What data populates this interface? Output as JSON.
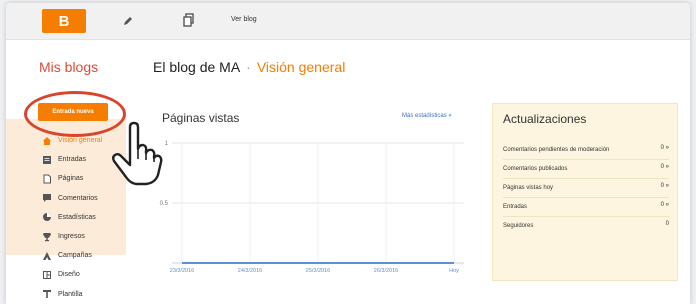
{
  "topbar": {
    "logo_letter": "B",
    "ver_blog": "Ver blog"
  },
  "header": {
    "mis_blogs": "Mis blogs",
    "blog_name": "El blog de MA",
    "separator": "·",
    "section": "Visión general"
  },
  "sidebar": {
    "new_post": "Entrada nueva",
    "items": [
      {
        "label": "Visión general",
        "icon": "home-icon"
      },
      {
        "label": "Entradas",
        "icon": "entries-icon"
      },
      {
        "label": "Páginas",
        "icon": "page-icon"
      },
      {
        "label": "Comentarios",
        "icon": "comment-icon"
      },
      {
        "label": "Estadísticas",
        "icon": "stats-icon"
      },
      {
        "label": "Ingresos",
        "icon": "trophy-icon"
      },
      {
        "label": "Campañas",
        "icon": "campaign-icon"
      },
      {
        "label": "Diseño",
        "icon": "layout-icon"
      },
      {
        "label": "Plantilla",
        "icon": "template-icon"
      }
    ]
  },
  "pageviews": {
    "title": "Páginas vistas",
    "more": "Más estadísticas »"
  },
  "chart_data": {
    "type": "line",
    "x": [
      "23/3/2016",
      "24/3/2016",
      "25/3/2016",
      "26/3/2016",
      "Hoy"
    ],
    "y_ticks": [
      "1",
      "0.5"
    ],
    "ylim": [
      0,
      1
    ],
    "series": [
      {
        "values": [
          0,
          0,
          0,
          0,
          0
        ]
      }
    ],
    "line_color": "#5b8fd6",
    "grid": true
  },
  "updates": {
    "title": "Actualizaciones",
    "rows": [
      {
        "label": "Comentarios pendientes de moderación",
        "value": "0 »"
      },
      {
        "label": "Comentarios publicados",
        "value": "0 »"
      },
      {
        "label": "Páginas vistas hoy",
        "value": "0 »"
      },
      {
        "label": "Entradas",
        "value": "0 »"
      },
      {
        "label": "Seguidores",
        "value": "0"
      }
    ]
  },
  "colors": {
    "accent": "#f57d00",
    "highlight_ring": "#d9452b",
    "link": "#3a6fc4",
    "updates_bg": "#fdf5df"
  }
}
